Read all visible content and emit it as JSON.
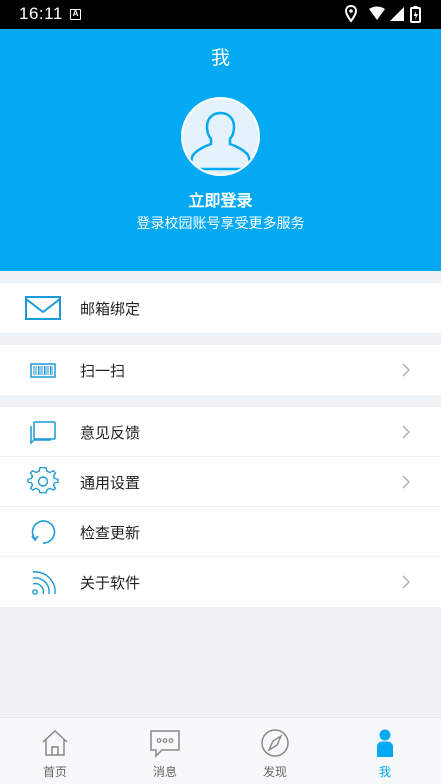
{
  "status_bar": {
    "time": "16:11",
    "a_badge": "A"
  },
  "header": {
    "title": "我",
    "login_title": "立即登录",
    "login_subtitle": "登录校园账号享受更多服务"
  },
  "menu": {
    "email_bind": "邮箱绑定",
    "scan": "扫一扫",
    "feedback": "意见反馈",
    "settings": "通用设置",
    "check_update": "检查更新",
    "about": "关于软件"
  },
  "tabs": [
    {
      "label": "首页",
      "icon": "home-icon"
    },
    {
      "label": "消息",
      "icon": "message-icon"
    },
    {
      "label": "发现",
      "icon": "compass-icon"
    },
    {
      "label": "我",
      "icon": "person-icon"
    }
  ],
  "colors": {
    "accent": "#03a9f3",
    "background": "#eef2f4"
  }
}
